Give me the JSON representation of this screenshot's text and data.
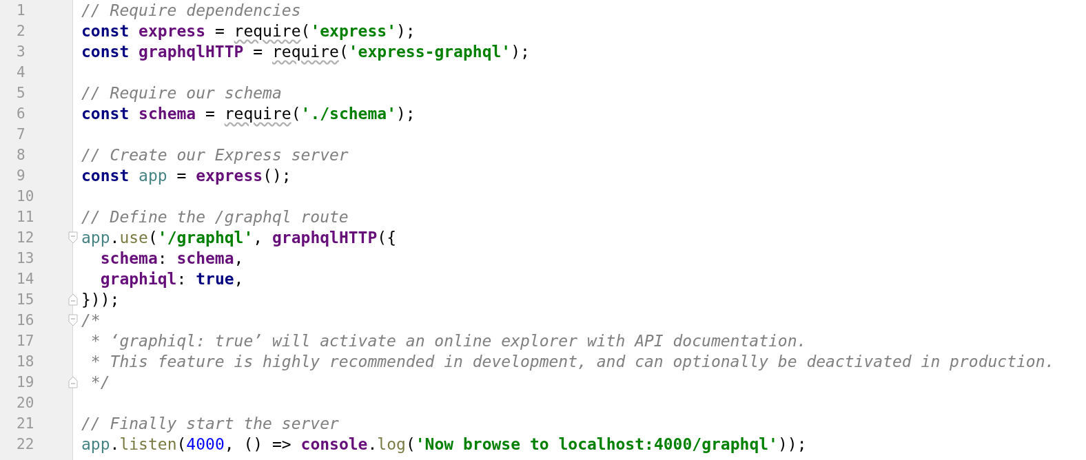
{
  "editor": {
    "lines": [
      {
        "number": "1",
        "tokens": [
          {
            "kind": "comment",
            "text": "// Require dependencies"
          }
        ]
      },
      {
        "number": "2",
        "tokens": [
          {
            "kind": "keyword",
            "text": "const "
          },
          {
            "kind": "variable",
            "text": "express"
          },
          {
            "kind": "plain",
            "text": " = "
          },
          {
            "kind": "squiggly",
            "text": "require"
          },
          {
            "kind": "plain",
            "text": "("
          },
          {
            "kind": "string",
            "text": "'express'"
          },
          {
            "kind": "plain",
            "text": ");"
          }
        ]
      },
      {
        "number": "3",
        "tokens": [
          {
            "kind": "keyword",
            "text": "const "
          },
          {
            "kind": "variable",
            "text": "graphqlHTTP"
          },
          {
            "kind": "plain",
            "text": " = "
          },
          {
            "kind": "squiggly",
            "text": "require"
          },
          {
            "kind": "plain",
            "text": "("
          },
          {
            "kind": "string",
            "text": "'express-graphql'"
          },
          {
            "kind": "plain",
            "text": ");"
          }
        ]
      },
      {
        "number": "4"
      },
      {
        "number": "5",
        "tokens": [
          {
            "kind": "comment",
            "text": "// Require our schema"
          }
        ]
      },
      {
        "number": "6",
        "tokens": [
          {
            "kind": "keyword",
            "text": "const "
          },
          {
            "kind": "variable",
            "text": "schema"
          },
          {
            "kind": "plain",
            "text": " = "
          },
          {
            "kind": "squiggly",
            "text": "require"
          },
          {
            "kind": "plain",
            "text": "("
          },
          {
            "kind": "string",
            "text": "'./schema'"
          },
          {
            "kind": "plain",
            "text": ");"
          }
        ]
      },
      {
        "number": "7"
      },
      {
        "number": "8",
        "tokens": [
          {
            "kind": "comment",
            "text": "// Create our Express server"
          }
        ]
      },
      {
        "number": "9",
        "tokens": [
          {
            "kind": "keyword",
            "text": "const "
          },
          {
            "kind": "identifier",
            "text": "app"
          },
          {
            "kind": "plain",
            "text": " = "
          },
          {
            "kind": "variable",
            "text": "express"
          },
          {
            "kind": "plain",
            "text": "();"
          }
        ]
      },
      {
        "number": "10"
      },
      {
        "number": "11",
        "tokens": [
          {
            "kind": "comment",
            "text": "// Define the /graphql route"
          }
        ]
      },
      {
        "number": "12",
        "fold_start": true,
        "tokens": [
          {
            "kind": "identifier",
            "text": "app"
          },
          {
            "kind": "plain",
            "text": "."
          },
          {
            "kind": "method",
            "text": "use"
          },
          {
            "kind": "plain",
            "text": "("
          },
          {
            "kind": "string",
            "text": "'/graphql'"
          },
          {
            "kind": "plain",
            "text": ", "
          },
          {
            "kind": "variable",
            "text": "graphqlHTTP"
          },
          {
            "kind": "plain",
            "text": "({"
          }
        ]
      },
      {
        "number": "13",
        "tokens": [
          {
            "kind": "variable",
            "text": "  schema"
          },
          {
            "kind": "plain",
            "text": ": "
          },
          {
            "kind": "variable",
            "text": "schema"
          },
          {
            "kind": "plain",
            "text": ","
          }
        ]
      },
      {
        "number": "14",
        "tokens": [
          {
            "kind": "variable",
            "text": "  graphiql"
          },
          {
            "kind": "plain",
            "text": ": "
          },
          {
            "kind": "keyword",
            "text": "true"
          },
          {
            "kind": "plain",
            "text": ","
          }
        ]
      },
      {
        "number": "15",
        "fold_end": true,
        "tokens": [
          {
            "kind": "plain",
            "text": "}));"
          }
        ]
      },
      {
        "number": "16",
        "fold_start": true,
        "tokens": [
          {
            "kind": "comment",
            "text": "/*"
          }
        ]
      },
      {
        "number": "17",
        "tokens": [
          {
            "kind": "comment",
            "text": " * ‘graphiql: true’ will activate an online explorer with API documentation."
          }
        ]
      },
      {
        "number": "18",
        "tokens": [
          {
            "kind": "comment",
            "text": " * This feature is highly recommended in development, and can optionally be deactivated in production."
          }
        ]
      },
      {
        "number": "19",
        "fold_end": true,
        "tokens": [
          {
            "kind": "comment",
            "text": " */"
          }
        ]
      },
      {
        "number": "20"
      },
      {
        "number": "21",
        "tokens": [
          {
            "kind": "comment",
            "text": "// Finally start the server"
          }
        ]
      },
      {
        "number": "22",
        "tokens": [
          {
            "kind": "identifier",
            "text": "app"
          },
          {
            "kind": "plain",
            "text": "."
          },
          {
            "kind": "method",
            "text": "listen"
          },
          {
            "kind": "plain",
            "text": "("
          },
          {
            "kind": "number",
            "text": "4000"
          },
          {
            "kind": "plain",
            "text": ", () => "
          },
          {
            "kind": "variable",
            "text": "console"
          },
          {
            "kind": "plain",
            "text": "."
          },
          {
            "kind": "method",
            "text": "log"
          },
          {
            "kind": "plain",
            "text": "("
          },
          {
            "kind": "string",
            "text": "'Now browse to localhost:4000/graphql'"
          },
          {
            "kind": "plain",
            "text": "));"
          }
        ]
      }
    ]
  }
}
